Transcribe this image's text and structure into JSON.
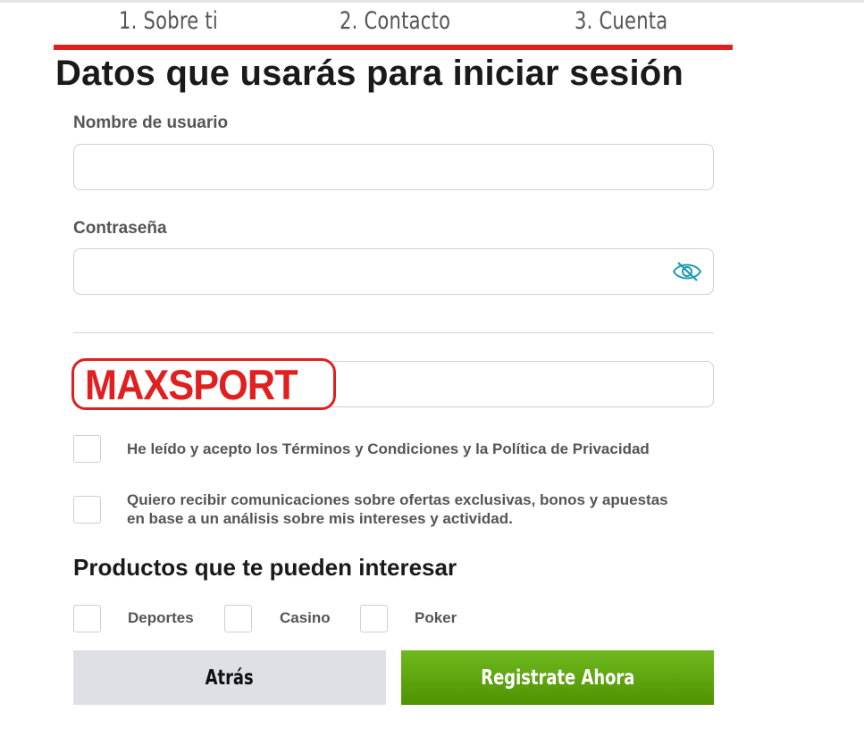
{
  "steps": [
    "1. Sobre ti",
    "2. Contacto",
    "3. Cuenta"
  ],
  "page_title": "Datos que usarás para iniciar sesión",
  "username": {
    "label": "Nombre de usuario",
    "value": ""
  },
  "password": {
    "label": "Contraseña",
    "value": "",
    "toggle_icon": "eye-slash-icon"
  },
  "promo": {
    "logo_text": "MAXSPORT",
    "value": ""
  },
  "consents": {
    "terms": "He leído y acepto los Términos y Condiciones y la Política de Privacidad",
    "communications": "Quiero recibir comunicaciones sobre ofertas exclusivas, bonos y apuestas en base a un análisis sobre mis intereses y actividad."
  },
  "products": {
    "title": "Productos que te pueden interesar",
    "items": [
      "Deportes",
      "Casino",
      "Poker"
    ]
  },
  "buttons": {
    "back": "Atrás",
    "register": "Registrate Ahora"
  },
  "colors": {
    "accent_red": "#e02020",
    "register_green": "#5fa610",
    "back_gray": "#dde1e5",
    "icon_teal": "#1a9bb0"
  }
}
